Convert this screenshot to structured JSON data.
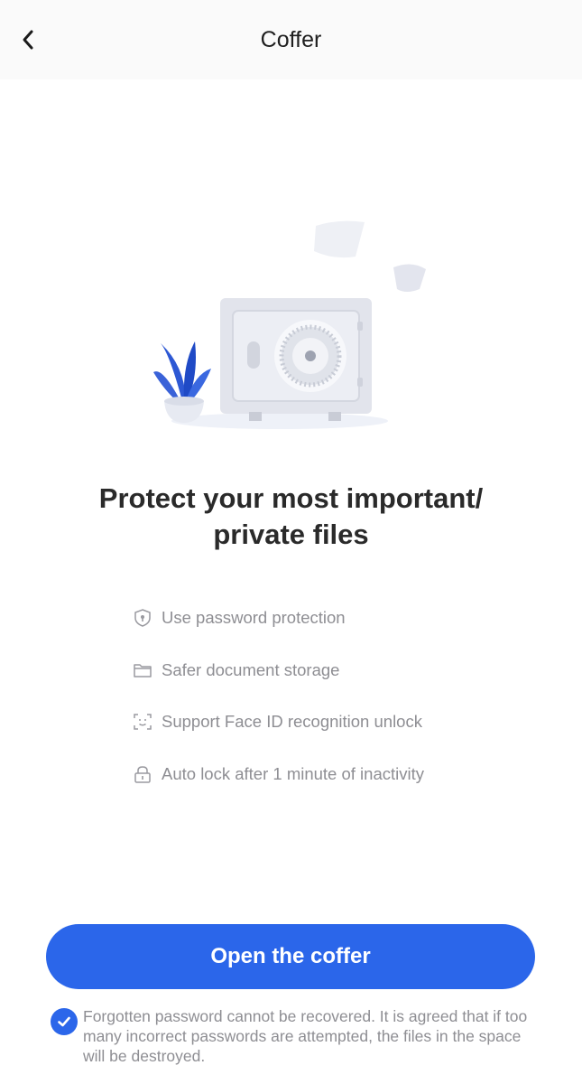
{
  "nav": {
    "back_icon": "chevron-left-icon",
    "title": "Coffer"
  },
  "illustration": {
    "description_icons": [
      "safe-icon",
      "plant-icon",
      "paper-icon"
    ],
    "accent": "#2b5fe0"
  },
  "headline": {
    "line1": "Protect your most important/",
    "line2": "private files"
  },
  "features": [
    {
      "icon": "shield-lock-icon",
      "label": "Use password protection"
    },
    {
      "icon": "folder-icon",
      "label": "Safer document storage"
    },
    {
      "icon": "face-id-icon",
      "label": "Support Face ID recognition unlock"
    },
    {
      "icon": "lock-icon",
      "label": "Auto lock after 1 minute of inactivity"
    }
  ],
  "cta": {
    "label": "Open the coffer",
    "color": "#2b66ea"
  },
  "agreement": {
    "checked": true,
    "text": "Forgotten password cannot be recovered. It is agreed that if too many incorrect passwords are attempted, the files in the space will be destroyed."
  }
}
